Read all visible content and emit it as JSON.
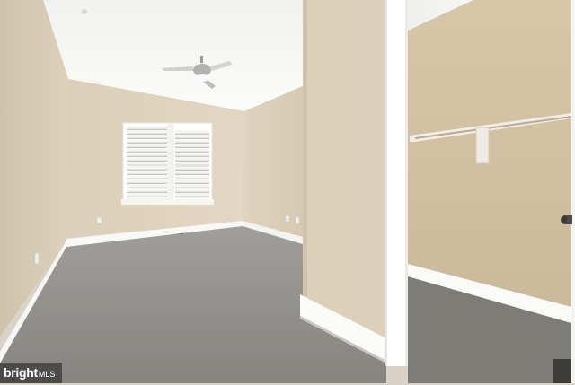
{
  "watermark": {
    "brand": "bright",
    "suffix": "MLS"
  },
  "colors": {
    "wall": "#d9cdb7",
    "ceiling": "#f4f4f2",
    "carpet": "#8e8c88",
    "trim": "#ffffff",
    "closet_wall": "#d2c1a4"
  }
}
